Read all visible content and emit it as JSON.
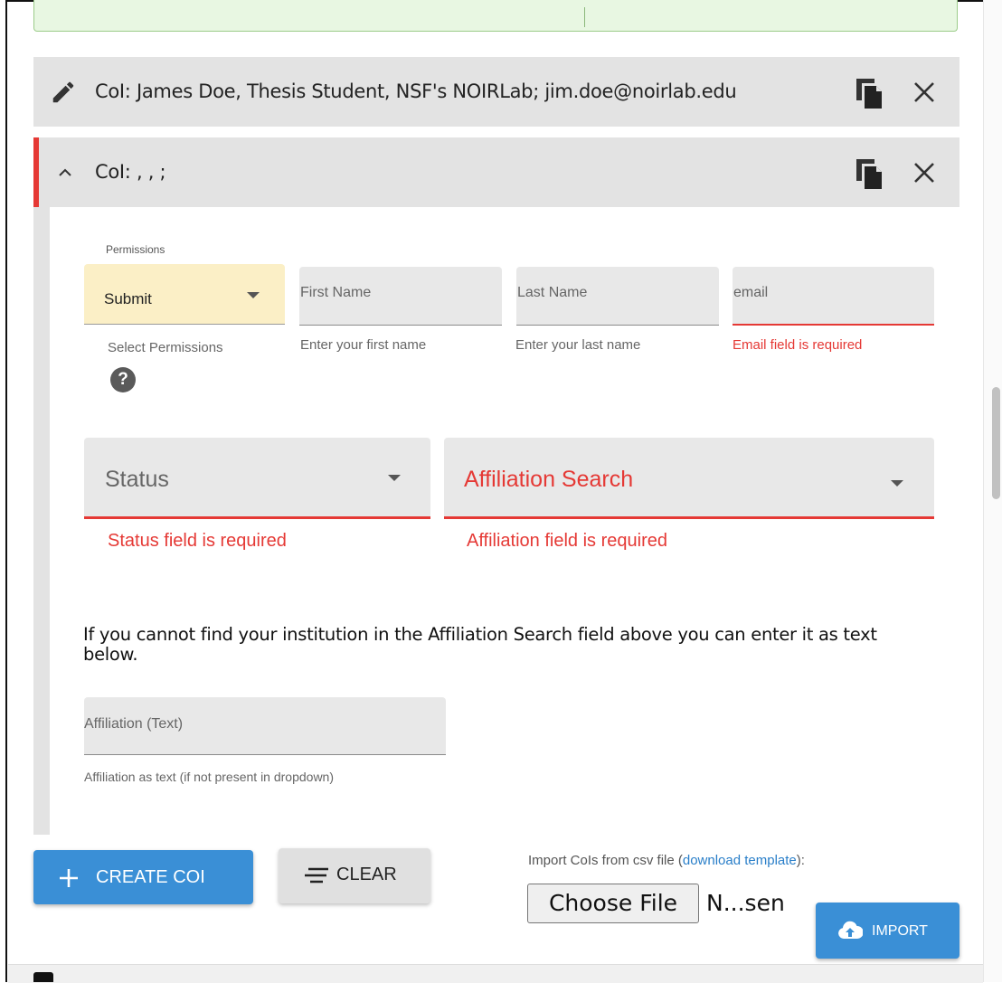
{
  "colors": {
    "accent": "#3a8fd6",
    "error": "#e53935",
    "panel_bg": "#e3e3e3",
    "permission_bg": "#fbefc6",
    "success_bg": "#e8f7e2"
  },
  "coi_list": [
    {
      "title": "CoI: James Doe,  Thesis Student,  NSF's NOIRLab;  jim.doe@noirlab.edu",
      "leading_icon": "pencil-icon",
      "actions": [
        "copy-icon",
        "close-icon"
      ]
    },
    {
      "title": "CoI: , , ;",
      "leading_icon": "chevron-up-icon",
      "actions": [
        "copy-icon",
        "close-icon"
      ]
    }
  ],
  "form": {
    "permissions": {
      "label": "Permissions",
      "value": "Submit",
      "hint": "Select Permissions",
      "help_icon": "question-icon"
    },
    "first_name": {
      "label": "First Name",
      "hint": "Enter your first name"
    },
    "last_name": {
      "label": "Last Name",
      "hint": "Enter your last name"
    },
    "email": {
      "label": "email",
      "error": "Email field is required"
    },
    "status": {
      "label": "Status",
      "error": "Status field is required"
    },
    "affiliation_search": {
      "label": "Affiliation Search",
      "error": "Affiliation field is required"
    },
    "affiliation_info": "If you cannot find your institution in the Affiliation Search field above you can enter it as text below.",
    "affiliation_text": {
      "label": "Affiliation (Text)",
      "hint": "Affiliation as text (if not present in dropdown)"
    }
  },
  "actions": {
    "create_label": "CREATE COI",
    "create_icon": "plus-icon",
    "clear_label": "CLEAR",
    "clear_icon": "clear-lines-icon"
  },
  "import": {
    "caption_prefix": "Import CoIs from csv file (",
    "template_link": "download template",
    "caption_suffix": "):",
    "choose_file_label": "Choose File",
    "file_status": "N...sen",
    "import_label": "IMPORT",
    "import_icon": "cloud-upload-icon"
  }
}
